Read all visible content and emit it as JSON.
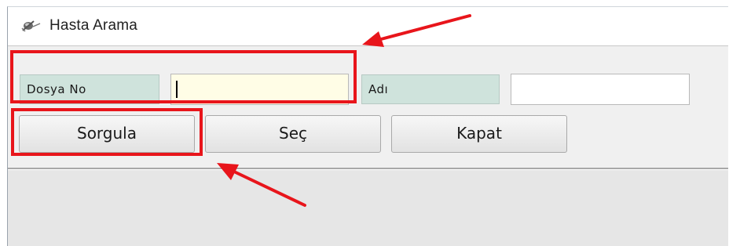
{
  "window": {
    "title": "Hasta Arama",
    "title_icon": "satellite-icon"
  },
  "form": {
    "dosya_no": {
      "label": "Dosya No",
      "value": "",
      "placeholder": "",
      "bg": "#fffde6"
    },
    "adi": {
      "label": "Adı",
      "value": "",
      "placeholder": "",
      "bg": "#ffffff"
    }
  },
  "buttons": {
    "sorgula": "Sorgula",
    "sec": "Seç",
    "kapat": "Kapat"
  },
  "annotations": {
    "color": "#e8151b",
    "highlighted": [
      "dosya-no-field-group",
      "sorgula-button"
    ]
  }
}
